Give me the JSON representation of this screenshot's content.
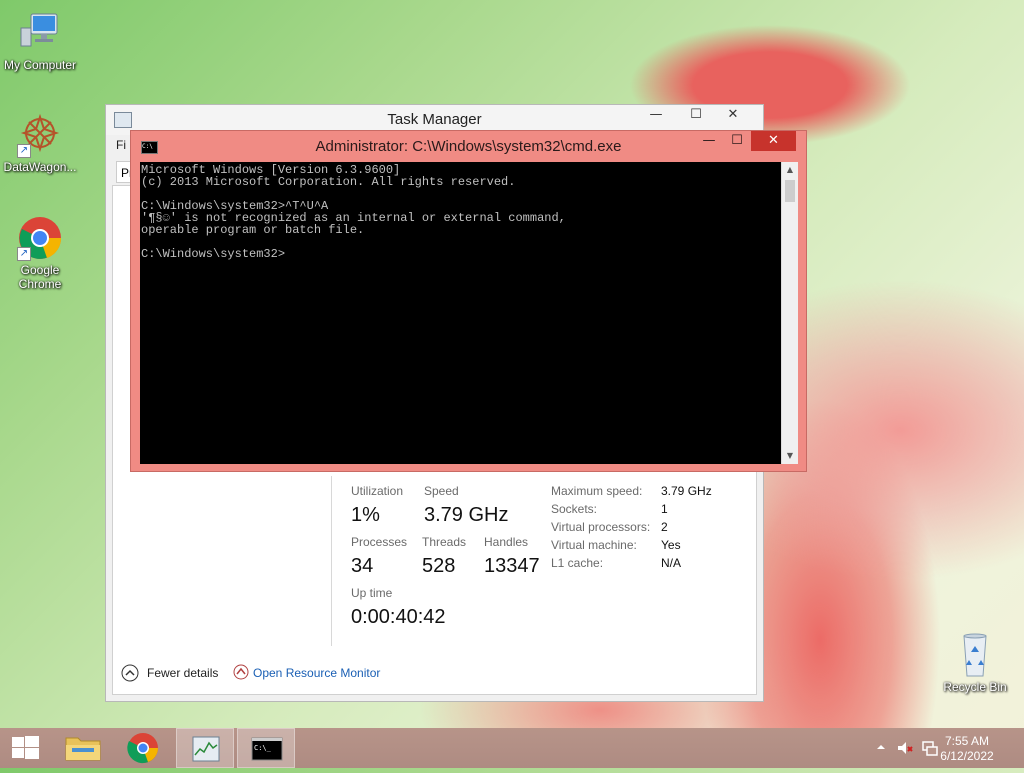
{
  "desktop": {
    "icons": [
      {
        "label": "My Computer"
      },
      {
        "label": "DataWagon..."
      },
      {
        "label_line1": "Google",
        "label_line2": "Chrome"
      },
      {
        "label": "Recycle Bin"
      }
    ]
  },
  "task_manager": {
    "title": "Task Manager",
    "menu_stub": "Fi",
    "tab_stub": "Pr",
    "stats": {
      "utilization_label": "Utilization",
      "utilization_value": "1%",
      "speed_label": "Speed",
      "speed_value": "3.79 GHz",
      "processes_label": "Processes",
      "processes_value": "34",
      "threads_label": "Threads",
      "threads_value": "528",
      "handles_label": "Handles",
      "handles_value": "13347",
      "uptime_label": "Up time",
      "uptime_value": "0:00:40:42"
    },
    "details": [
      {
        "label": "Maximum speed:",
        "value": "3.79 GHz"
      },
      {
        "label": "Sockets:",
        "value": "1"
      },
      {
        "label": "Virtual processors:",
        "value": "2"
      },
      {
        "label": "Virtual machine:",
        "value": "Yes"
      },
      {
        "label": "L1 cache:",
        "value": "N/A"
      }
    ],
    "fewer_details": "Fewer details",
    "open_resource_monitor": "Open Resource Monitor"
  },
  "cmd": {
    "title": "Administrator: C:\\Windows\\system32\\cmd.exe",
    "lines": [
      "Microsoft Windows [Version 6.3.9600]",
      "(c) 2013 Microsoft Corporation. All rights reserved.",
      "",
      "C:\\Windows\\system32>^T^U^A",
      "'¶§☺' is not recognized as an internal or external command,",
      "operable program or batch file.",
      "",
      "C:\\Windows\\system32>"
    ]
  },
  "taskbar": {
    "clock_time": "7:55 AM",
    "clock_date": "6/12/2022"
  },
  "colors": {
    "cmd_frame": "#f08b84",
    "close_red": "#c7332c",
    "link_blue": "#1a5fb4"
  }
}
